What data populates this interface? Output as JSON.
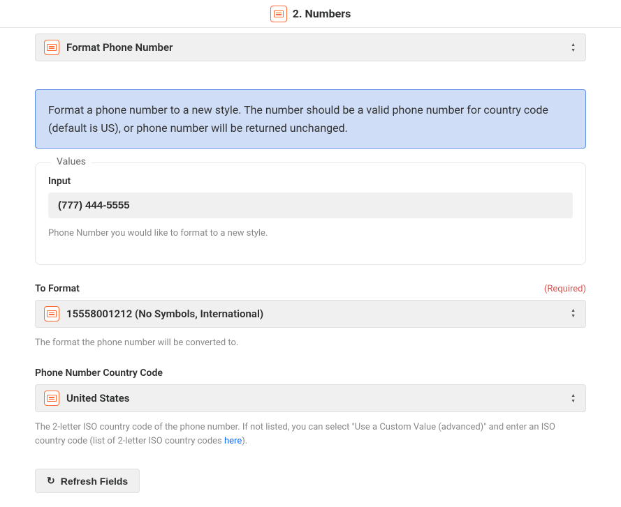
{
  "header": {
    "title": "2. Numbers"
  },
  "action_select": {
    "label": "Format Phone Number"
  },
  "description": "Format a phone number to a new style. The number should be a valid phone number for country code (default is US), or phone number will be returned unchanged.",
  "values_section": {
    "legend": "Values",
    "input_label": "Input",
    "input_value": "(777) 444-5555",
    "input_hint": "Phone Number you would like to format to a new style."
  },
  "to_format": {
    "label": "To Format",
    "required": "(Required)",
    "value": "15558001212 (No Symbols, International)",
    "hint": "The format the phone number will be converted to."
  },
  "country_code": {
    "label": "Phone Number Country Code",
    "value": "United States",
    "hint_prefix": "The 2-letter ISO country code of the phone number. If not listed, you can select \"Use a Custom Value (advanced)\" and enter an ISO country code (list of 2-letter ISO country codes ",
    "hint_link": "here",
    "hint_suffix": ")."
  },
  "refresh_button": "Refresh Fields"
}
